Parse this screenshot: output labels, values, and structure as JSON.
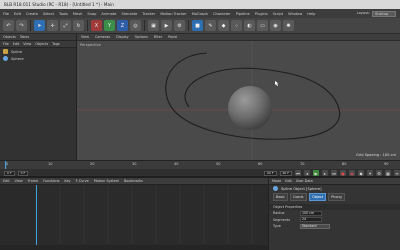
{
  "window": {
    "title": "BLB R18.011 Studio (RC - R18) - [Untitled 1 *] - Main"
  },
  "menu": {
    "items": [
      "File",
      "Edit",
      "Create",
      "Select",
      "Tools",
      "Mesh",
      "Snap",
      "Animate",
      "Simulate",
      "Tracker",
      "Motion Tracker",
      "MoGraph",
      "Character",
      "Pipeline",
      "Plugins",
      "Script",
      "Window",
      "Help"
    ],
    "layout_label": "Layout:",
    "layout_value": "Startup"
  },
  "toolbar": {
    "buttons": [
      "undo",
      "redo",
      "select",
      "move",
      "scale",
      "rotate",
      "X",
      "Y",
      "Z",
      "world",
      "render-region",
      "render",
      "render-settings",
      "cube",
      "pen",
      "subdivide",
      "array",
      "deformer",
      "floor",
      "camera",
      "light"
    ]
  },
  "objects_panel": {
    "header": [
      "Objects",
      "Takes"
    ],
    "menu": [
      "File",
      "Edit",
      "View",
      "Objects",
      "Tags",
      "Bookmarks"
    ],
    "items": [
      {
        "name": "Spline",
        "icon": "spline-icon"
      },
      {
        "name": "Sphere",
        "icon": "sphere-icon"
      }
    ]
  },
  "viewport": {
    "menu": [
      "View",
      "Cameras",
      "Display",
      "Options",
      "Filter",
      "Panel"
    ],
    "label": "Perspective",
    "footer": "Grid Spacing : 100 cm"
  },
  "timeline": {
    "ticks": [
      "0",
      "10",
      "20",
      "30",
      "40",
      "50",
      "60",
      "70",
      "80",
      "90"
    ],
    "start_field": "0 F",
    "current_field": "0 F",
    "end_field": "90 F",
    "end_field2": "90 F",
    "frame_readout": "0 F"
  },
  "anim_panel": {
    "menu": [
      "Edit",
      "View",
      "Frame",
      "Functions",
      "Key",
      "F-Curve",
      "Motion System",
      "Bookmarks"
    ]
  },
  "attributes_panel": {
    "header": [
      "Mode",
      "Edit",
      "User Data"
    ],
    "title": "Spline Object [Sphere]",
    "tabs": [
      "Basic",
      "Coord.",
      "Object",
      "Phong"
    ],
    "active_tab": "Object",
    "section": "Object Properties",
    "rows": [
      {
        "label": "Radius",
        "value": "100 cm"
      },
      {
        "label": "Segments",
        "value": "24"
      },
      {
        "label": "Type",
        "value": "Standard"
      }
    ]
  },
  "colors": {
    "accent": "#2e6fb3",
    "viewport_bg": "#4a4a4a",
    "panel_bg": "#323232"
  }
}
